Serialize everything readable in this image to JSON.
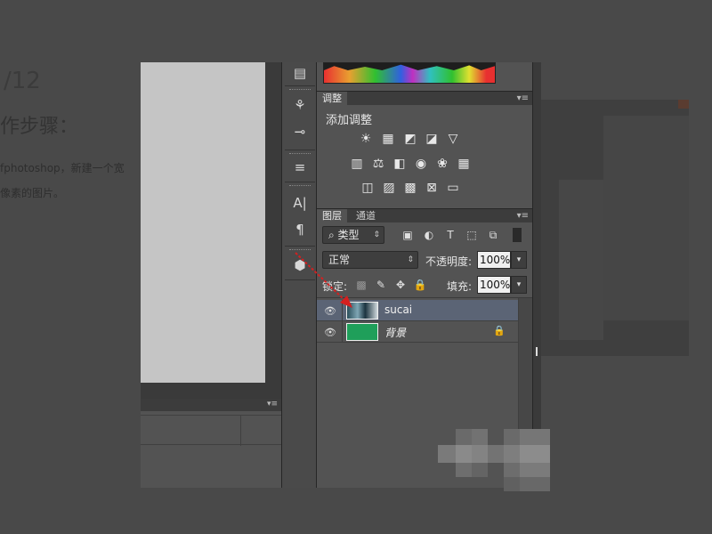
{
  "background_page": {
    "step_counter": "/12",
    "heading": "作步骤：",
    "line1": "fphotoshop，新建一个宽",
    "line2": "像素的图片。"
  },
  "tools": [
    {
      "name": "brush-presets-icon",
      "glyph": "⚘"
    },
    {
      "name": "clone-source-icon",
      "glyph": "⊸"
    },
    {
      "name": "tool-presets-icon",
      "glyph": "≡"
    },
    {
      "name": "character-icon",
      "glyph": "A|"
    },
    {
      "name": "paragraph-icon",
      "glyph": "¶"
    },
    {
      "name": "3d-icon",
      "glyph": "⬢"
    }
  ],
  "adjustments_panel": {
    "tab": "调整",
    "title": "添加调整",
    "icons": [
      [
        "brightness-icon",
        "levels-icon",
        "curves-icon",
        "exposure-icon",
        "vibrance-icon"
      ],
      [
        "hue-saturation-icon",
        "color-balance-icon",
        "black-white-icon",
        "photo-filter-icon",
        "channel-mixer-icon",
        "color-lookup-icon"
      ],
      [
        "invert-icon",
        "posterize-icon",
        "threshold-icon",
        "selective-color-icon",
        "gradient-map-icon"
      ]
    ]
  },
  "layers_panel": {
    "tabs": [
      "图层",
      "通道"
    ],
    "filter_kind": "类型",
    "blend_mode": "正常",
    "opacity_label": "不透明度:",
    "opacity_value": "100%",
    "lock_label": "锁定:",
    "fill_label": "填充:",
    "fill_value": "100%",
    "layers": [
      {
        "name": "sucai",
        "selected": true,
        "italic": false,
        "locked": false
      },
      {
        "name": "背景",
        "selected": false,
        "italic": true,
        "locked": true
      }
    ]
  },
  "colors": {
    "background_layer_thumb": "#1f9f5a",
    "selected_layer": "#5b6475",
    "annotation_arrow": "#d42020"
  }
}
